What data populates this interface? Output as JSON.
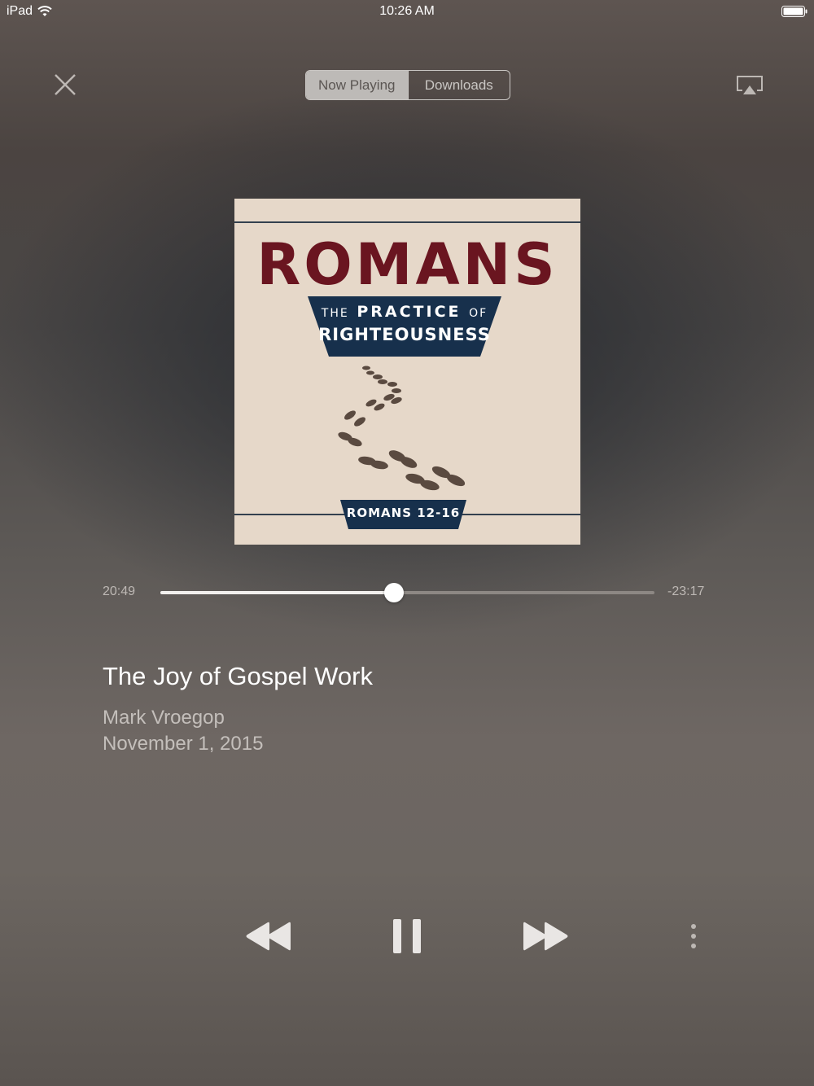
{
  "status_bar": {
    "device": "iPad",
    "time": "10:26 AM",
    "icons": [
      "wifi-icon",
      "battery-icon"
    ]
  },
  "header": {
    "close_icon": "close-icon",
    "tabs": [
      {
        "label": "Now Playing",
        "active": true
      },
      {
        "label": "Downloads",
        "active": false
      }
    ],
    "airplay_icon": "airplay-icon"
  },
  "artwork": {
    "title": "ROMANS",
    "subtitle_the": "THE",
    "subtitle_practice": "PRACTICE",
    "subtitle_of": "OF",
    "subtitle_righteousness": "RIGHTEOUSNESS",
    "reference": "ROMANS 12-16",
    "colors": {
      "background": "#e6d8c9",
      "title": "#6a1520",
      "banner": "#17304c",
      "footprints": "#5a4a40"
    }
  },
  "playback": {
    "elapsed": "20:49",
    "remaining": "-23:17",
    "progress_fraction": 0.473
  },
  "track": {
    "title": "The Joy of Gospel Work",
    "speaker": "Mark Vroegop",
    "date": "November 1, 2015"
  },
  "controls": {
    "rewind_icon": "rewind-icon",
    "pause_icon": "pause-icon",
    "forward_icon": "fast-forward-icon",
    "more_icon": "more-vertical-icon"
  }
}
